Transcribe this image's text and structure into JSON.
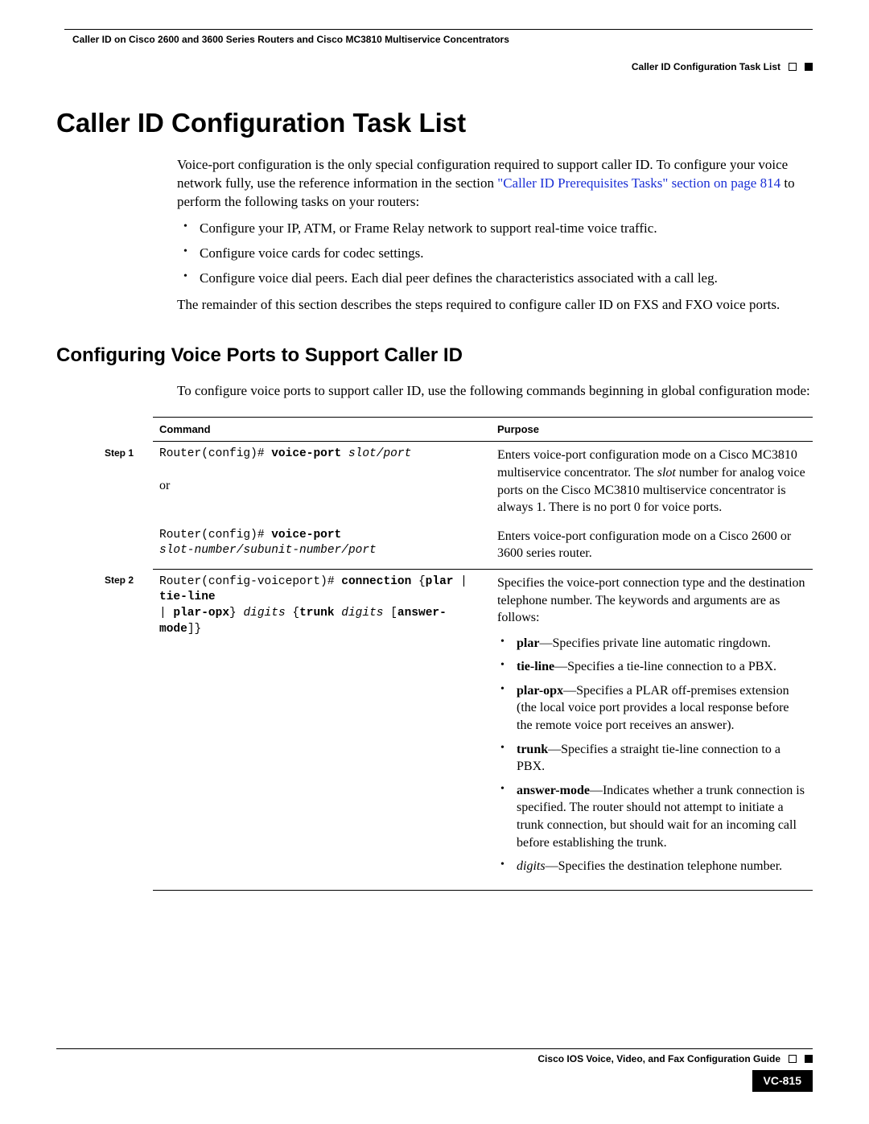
{
  "header": {
    "doc_title": "Caller ID on Cisco 2600 and 3600 Series Routers and Cisco MC3810 Multiservice Concentrators",
    "breadcrumb": "Caller ID Configuration Task List"
  },
  "h1": "Caller ID Configuration Task List",
  "intro": {
    "p1_a": "Voice-port configuration is the only special configuration required to support caller ID. To configure your voice network fully, use the reference information in the section ",
    "p1_link": "\"Caller ID Prerequisites Tasks\" section on page 814",
    "p1_b": " to perform the following tasks on your routers:",
    "bullets": [
      "Configure your IP, ATM, or Frame Relay network to support real-time voice traffic.",
      "Configure voice cards for codec settings.",
      "Configure voice dial peers. Each dial peer defines the characteristics associated with a call leg."
    ],
    "p2": "The remainder of this section describes the steps required to configure caller ID on FXS and FXO voice ports."
  },
  "h2": "Configuring Voice Ports to Support Caller ID",
  "sub_intro": "To configure voice ports to support caller ID, use the following commands beginning in global configuration mode:",
  "table": {
    "head_command": "Command",
    "head_purpose": "Purpose",
    "step1_label": "Step 1",
    "step2_label": "Step 2",
    "row1": {
      "cmd1_prefix": "Router(config)# ",
      "cmd1_bold": "voice-port",
      "cmd1_args": " slot/port",
      "or": "or",
      "cmd2_prefix": "Router(config)# ",
      "cmd2_bold": "voice-port",
      "cmd2_args": "slot-number/subunit-number/port",
      "purpose1_a": "Enters voice-port configuration mode on a Cisco MC3810 multiservice concentrator. The ",
      "purpose1_ital": "slot",
      "purpose1_b": " number for analog voice ports on the Cisco MC3810 multiservice concentrator is always 1. There is no port 0 for voice ports.",
      "purpose2": "Enters voice-port configuration mode on a Cisco 2600 or 3600 series router."
    },
    "row2": {
      "cmd_prefix": "Router(config-voiceport)# ",
      "cmd_bold1": "connection",
      "cmd_brace_open": " {",
      "cmd_plar": "plar",
      "cmd_pipe1": " | ",
      "cmd_tieline": "tie-line",
      "cmd_pipe2": " | ",
      "cmd_plaropx": "plar-opx",
      "cmd_brace_close": "} ",
      "cmd_digits_ital": "digits",
      "cmd_trunk_open": " {",
      "cmd_trunk": "trunk",
      "cmd_trunk_digits": " digits",
      "cmd_ans_open": " [",
      "cmd_answer": "answer-mode",
      "cmd_ans_close": "]}",
      "purpose_intro": "Specifies the voice-port connection type and the destination telephone number. The keywords and arguments are as follows:",
      "items": [
        {
          "kw": "plar",
          "txt": "—Specifies private line automatic ringdown."
        },
        {
          "kw": "tie-line",
          "txt": "—Specifies a tie-line connection to a PBX."
        },
        {
          "kw": "plar-opx",
          "txt": "—Specifies a PLAR off-premises extension (the local voice port provides a local response before the remote voice port receives an answer)."
        },
        {
          "kw": "trunk",
          "txt": "—Specifies a straight tie-line connection to a PBX."
        },
        {
          "kw": "answer-mode",
          "txt": "—Indicates whether a trunk connection is specified. The router should not attempt to initiate a trunk connection, but should wait for an incoming call before establishing the trunk."
        },
        {
          "kw_ital": "digits",
          "txt": "—Specifies the destination telephone number."
        }
      ]
    }
  },
  "footer": {
    "guide": "Cisco IOS Voice, Video, and Fax Configuration Guide",
    "page": "VC-815"
  }
}
